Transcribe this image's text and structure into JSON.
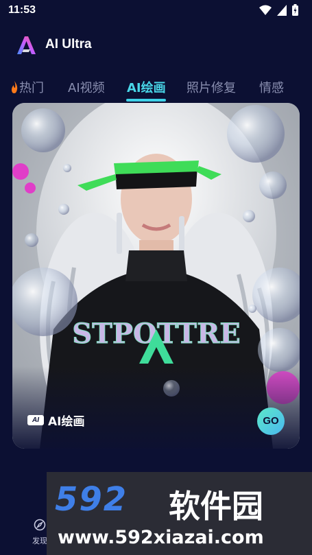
{
  "status_bar": {
    "time": "11:53",
    "icons": [
      "wifi-icon",
      "signal-icon",
      "battery-icon"
    ]
  },
  "header": {
    "logo": "ai-ultra-logo",
    "title": "AI Ultra"
  },
  "tabs": [
    {
      "label": "热门",
      "icon": "fire-icon",
      "active": false
    },
    {
      "label": "AI视频",
      "active": false
    },
    {
      "label": "AI绘画",
      "active": true
    },
    {
      "label": "照片修复",
      "active": false
    },
    {
      "label": "情感",
      "active": false
    }
  ],
  "card": {
    "badge": "AI",
    "label": "AI绘画",
    "go_label": "GO",
    "artwork_text": "STPOTTRE"
  },
  "bottom_nav": {
    "discover_label": "发现",
    "discover_icon": "compass-icon"
  },
  "watermark": {
    "logo_number": "592",
    "logo_cn": "软件园",
    "url": "www.592xiazai.com"
  },
  "colors": {
    "background": "#0c1033",
    "accent": "#49d6e8",
    "inactive_tab": "#8a8fb0"
  }
}
